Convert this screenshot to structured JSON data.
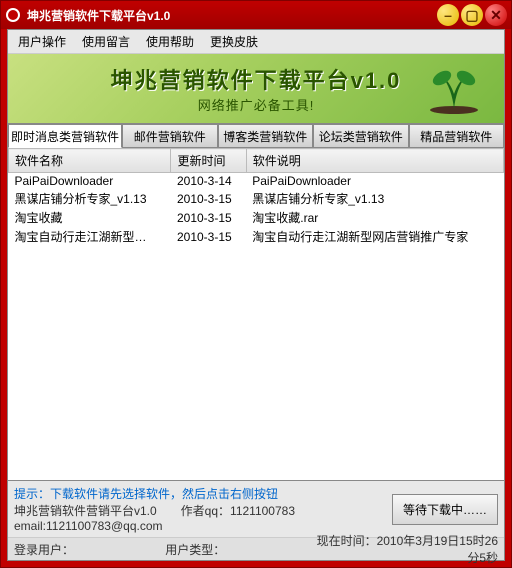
{
  "window": {
    "title": "坤兆营销软件下载平台v1.0"
  },
  "menu": {
    "items": [
      "用户操作",
      "使用留言",
      "使用帮助",
      "更换皮肤"
    ]
  },
  "banner": {
    "title": "坤兆营销软件下载平台v1.0",
    "subtitle": "网络推广必备工具!"
  },
  "tabs": {
    "items": [
      "即时消息类营销软件",
      "邮件营销软件",
      "博客类营销软件",
      "论坛类营销软件",
      "精品营销软件"
    ],
    "active": 0
  },
  "table": {
    "headers": [
      "软件名称",
      "更新时间",
      "软件说明"
    ],
    "rows": [
      [
        "PaiPaiDownloader",
        "2010-3-14",
        "PaiPaiDownloader"
      ],
      [
        "黑谋店铺分析专家_v1.13",
        "2010-3-15",
        "黑谋店铺分析专家_v1.13"
      ],
      [
        "淘宝收藏",
        "2010-3-15",
        "淘宝收藏.rar"
      ],
      [
        "淘宝自动行走江湖新型…",
        "2010-3-15",
        "淘宝自动行走江湖新型网店营销推广专家"
      ]
    ]
  },
  "hint": {
    "line1": "提示：下载软件请先选择软件，然后点击右侧按钮",
    "line2": "坤兆营销软件营销平台v1.0　　作者qq：1121100783",
    "line3": "email:1121100783@qq.com",
    "download_btn": "等待下载中……"
  },
  "status": {
    "user_label": "登录用户：",
    "type_label": "用户类型：",
    "time_label": "现在时间：",
    "time_value": "2010年3月19日15时26分5秒"
  }
}
